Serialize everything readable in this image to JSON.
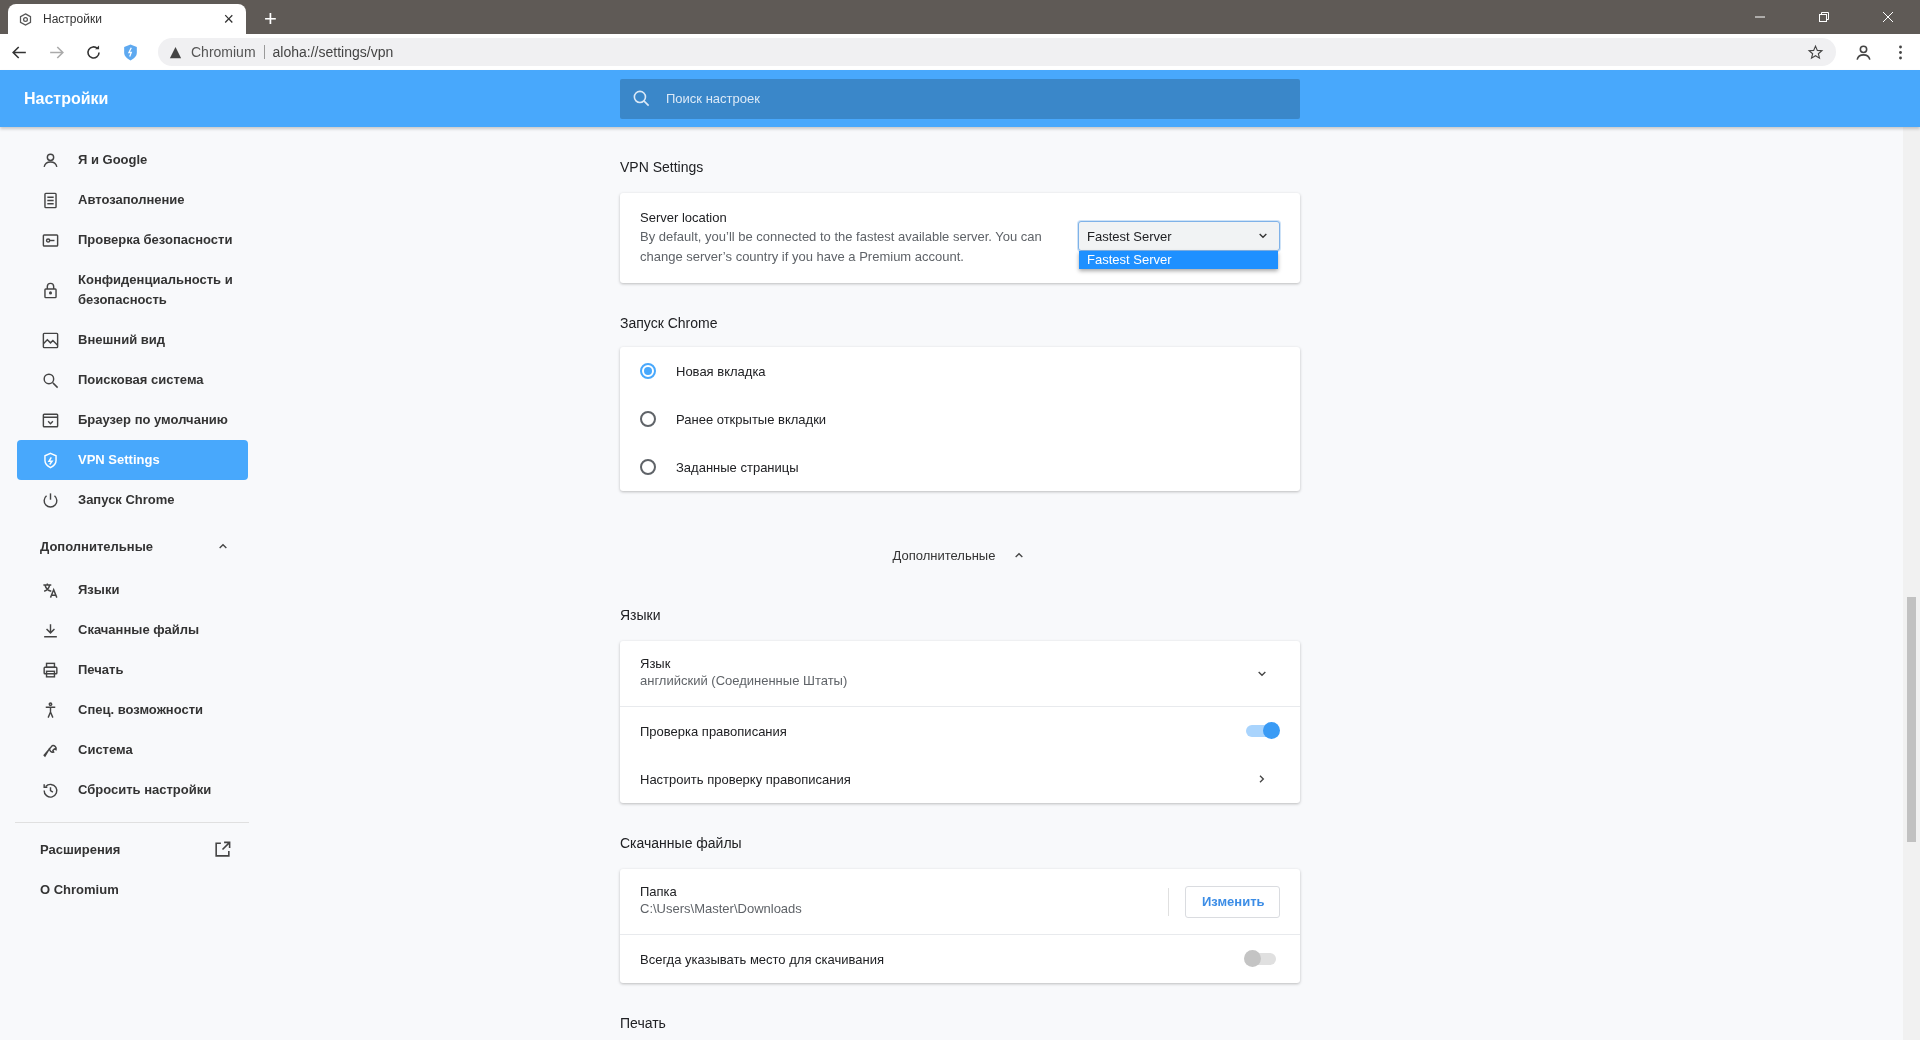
{
  "browser": {
    "tab": {
      "title": "Настройки",
      "close": "×"
    },
    "new_tab": "+",
    "address": {
      "site": "Chromium",
      "url": "aloha://settings/vpn"
    }
  },
  "header": {
    "title": "Настройки",
    "search": {
      "placeholder": "Поиск настроек"
    }
  },
  "sidebar": {
    "items": [
      {
        "label": "Я и Google",
        "selected": false
      },
      {
        "label": "Автозаполнение",
        "selected": false
      },
      {
        "label": "Проверка безопасности",
        "selected": false
      },
      {
        "label": "Конфиденциальность и безопасность",
        "selected": false
      },
      {
        "label": "Внешний вид",
        "selected": false
      },
      {
        "label": "Поисковая система",
        "selected": false
      },
      {
        "label": "Браузер по умолчанию",
        "selected": false
      },
      {
        "label": "VPN Settings",
        "selected": true
      },
      {
        "label": "Запуск Chrome",
        "selected": false
      }
    ],
    "advanced": {
      "label": "Дополнительные",
      "expanded": true,
      "items": [
        {
          "label": "Языки",
          "selected": false
        },
        {
          "label": "Скачанные файлы",
          "selected": false
        },
        {
          "label": "Печать",
          "selected": false
        },
        {
          "label": "Спец. возможности",
          "selected": false
        },
        {
          "label": "Система",
          "selected": false
        },
        {
          "label": "Сбросить настройки",
          "selected": false
        }
      ]
    },
    "extensions": "Расширения",
    "about": "О Chromium"
  },
  "vpn": {
    "heading": "VPN Settings",
    "label": "Server location",
    "description": "By default, you’ll be connected to the fastest available server. You can change server’s country if you have a Premium account.",
    "select": {
      "value": "Fastest Server",
      "open": true,
      "options": [
        {
          "label": "Fastest Server",
          "selected": true
        }
      ]
    }
  },
  "startup": {
    "heading": "Запуск Chrome",
    "options": [
      {
        "label": "Новая вкладка",
        "selected": true
      },
      {
        "label": "Ранее открытые вкладки",
        "selected": false
      },
      {
        "label": "Заданные страницы",
        "selected": false
      }
    ]
  },
  "advanced_toggle": {
    "label": "Дополнительные",
    "expanded": true
  },
  "languages": {
    "heading": "Языки",
    "rows": [
      {
        "kind": "expand",
        "label": "Язык",
        "sublabel": "английский (Соединенные Штаты)"
      },
      {
        "kind": "toggle",
        "label": "Проверка правописания",
        "on": true
      },
      {
        "kind": "link",
        "label": "Настроить проверку правописания"
      }
    ]
  },
  "downloads": {
    "heading": "Скачанные файлы",
    "rows": [
      {
        "kind": "folder",
        "label": "Папка",
        "sublabel": "C:\\Users\\Master\\Downloads",
        "button": "Изменить"
      },
      {
        "kind": "toggle",
        "label": "Всегда указывать место для скачивания",
        "on": false
      }
    ]
  },
  "print": {
    "heading": "Печать"
  }
}
